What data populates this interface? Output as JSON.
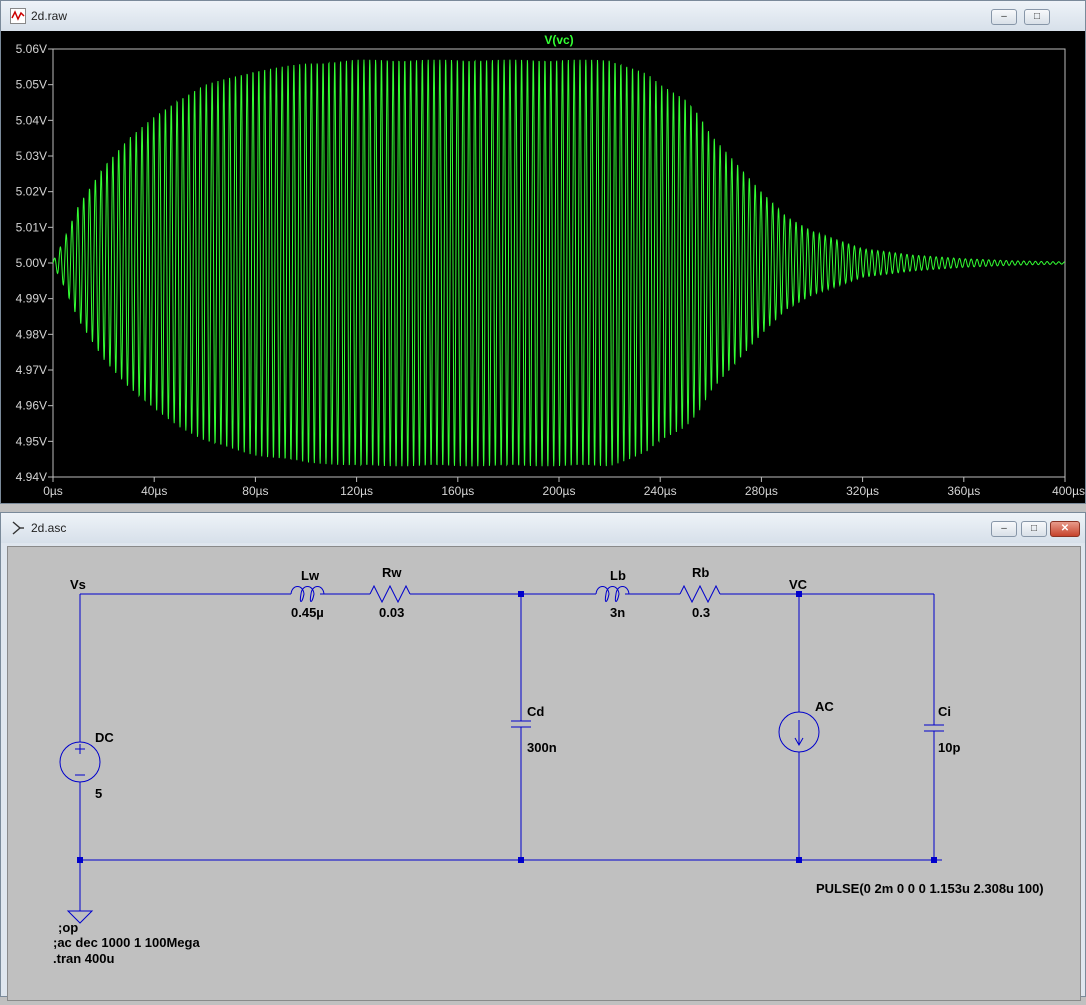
{
  "waveform_window": {
    "title": "2d.raw",
    "trace_label": "V(vc)",
    "colors": {
      "trace": "#33ff33",
      "axis": "#bdbdbd",
      "text": "#d4d4d4"
    },
    "controls": {
      "minimize": "–",
      "maximize": "□"
    }
  },
  "schematic_window": {
    "title": "2d.asc",
    "controls": {
      "minimize": "–",
      "maximize": "□",
      "close": "✕"
    },
    "colors": {
      "wire": "#0000cc",
      "background": "#c0c0c0"
    },
    "labels": {
      "vs": "Vs",
      "vc": "VC",
      "lw_name": "Lw",
      "lw_value": "0.45µ",
      "rw_name": "Rw",
      "rw_value": "0.03",
      "lb_name": "Lb",
      "lb_value": "3n",
      "rb_name": "Rb",
      "rb_value": "0.3",
      "cd_name": "Cd",
      "cd_value": "300n",
      "ac_name": "AC",
      "ci_name": "Ci",
      "ci_value": "10p",
      "dc_name": "DC",
      "dc_value": "5",
      "pulse": "PULSE(0 2m 0 0 0 1.153u 2.308u 100)",
      "op": ";op",
      "ac_cmd": ";ac dec 1000 1 100Mega",
      "tran": ".tran 400u"
    }
  },
  "chart_data": {
    "type": "line",
    "title": "V(vc)",
    "xlabel": "",
    "ylabel": "",
    "xlim": [
      0,
      400
    ],
    "ylim": [
      4.94,
      5.06
    ],
    "x_ticks": [
      "0µs",
      "40µs",
      "80µs",
      "120µs",
      "160µs",
      "200µs",
      "240µs",
      "280µs",
      "320µs",
      "360µs",
      "400µs"
    ],
    "y_ticks": [
      "5.06V",
      "5.05V",
      "5.04V",
      "5.03V",
      "5.02V",
      "5.01V",
      "5.00V",
      "4.99V",
      "4.98V",
      "4.97V",
      "4.96V",
      "4.95V",
      "4.94V"
    ],
    "grid": false,
    "series": [
      {
        "name": "V(vc)",
        "offset": 5.0,
        "oscillation_period_us": 2.308,
        "envelope_us": [
          0,
          4,
          10,
          20,
          30,
          40,
          50,
          60,
          80,
          100,
          120,
          140,
          160,
          180,
          200,
          220,
          228,
          235,
          240,
          250,
          255,
          260,
          270,
          280,
          290,
          300,
          320,
          340,
          360,
          380,
          400
        ],
        "envelope_amplitude_v": [
          0.0005,
          0.006,
          0.016,
          0.027,
          0.035,
          0.041,
          0.046,
          0.05,
          0.054,
          0.056,
          0.057,
          0.057,
          0.057,
          0.057,
          0.057,
          0.057,
          0.055,
          0.053,
          0.05,
          0.046,
          0.042,
          0.036,
          0.028,
          0.02,
          0.013,
          0.009,
          0.004,
          0.0022,
          0.0012,
          0.0006,
          0.0003
        ]
      }
    ]
  }
}
